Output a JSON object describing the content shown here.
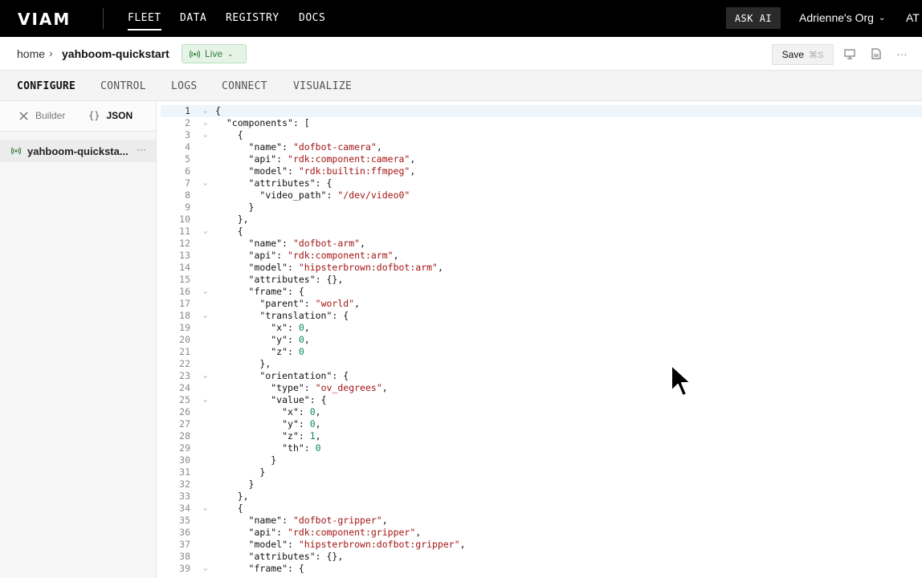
{
  "nav": {
    "logo": "VIAM",
    "links": [
      "FLEET",
      "DATA",
      "REGISTRY",
      "DOCS"
    ],
    "active_link": "FLEET",
    "ask_ai": "ASK AI",
    "org": "Adrienne's Org",
    "user_initials": "AT"
  },
  "breadcrumb": {
    "home": "home",
    "separator": "›",
    "machine": "yahboom-quickstart",
    "status": "Live"
  },
  "toolbar": {
    "save_label": "Save",
    "save_shortcut": "⌘S"
  },
  "tabs": [
    "CONFIGURE",
    "CONTROL",
    "LOGS",
    "CONNECT",
    "VISUALIZE"
  ],
  "active_tab": "CONFIGURE",
  "sidebar": {
    "mode_builder": "Builder",
    "mode_json_brace": "{}",
    "mode_json": "JSON",
    "machine_name": "yahboom-quicksta...",
    "more": "···"
  },
  "colors": {
    "accent_live": "#2e7d32",
    "string": "#a31515",
    "number": "#098658"
  },
  "editor": {
    "current_line": 1,
    "lines": [
      {
        "n": "1",
        "fold": true,
        "code": "{"
      },
      {
        "n": "2",
        "fold": true,
        "code": "  \"components\": ["
      },
      {
        "n": "3",
        "fold": true,
        "code": "    {"
      },
      {
        "n": "4",
        "fold": false,
        "code": "      \"name\": \"dofbot-camera\","
      },
      {
        "n": "5",
        "fold": false,
        "code": "      \"api\": \"rdk:component:camera\","
      },
      {
        "n": "6",
        "fold": false,
        "code": "      \"model\": \"rdk:builtin:ffmpeg\","
      },
      {
        "n": "7",
        "fold": true,
        "code": "      \"attributes\": {"
      },
      {
        "n": "8",
        "fold": false,
        "code": "        \"video_path\": \"/dev/video0\""
      },
      {
        "n": "9",
        "fold": false,
        "code": "      }"
      },
      {
        "n": "10",
        "fold": false,
        "code": "    },"
      },
      {
        "n": "11",
        "fold": true,
        "code": "    {"
      },
      {
        "n": "12",
        "fold": false,
        "code": "      \"name\": \"dofbot-arm\","
      },
      {
        "n": "13",
        "fold": false,
        "code": "      \"api\": \"rdk:component:arm\","
      },
      {
        "n": "14",
        "fold": false,
        "code": "      \"model\": \"hipsterbrown:dofbot:arm\","
      },
      {
        "n": "15",
        "fold": false,
        "code": "      \"attributes\": {},"
      },
      {
        "n": "16",
        "fold": true,
        "code": "      \"frame\": {"
      },
      {
        "n": "17",
        "fold": false,
        "code": "        \"parent\": \"world\","
      },
      {
        "n": "18",
        "fold": true,
        "code": "        \"translation\": {"
      },
      {
        "n": "19",
        "fold": false,
        "code": "          \"x\": 0,"
      },
      {
        "n": "20",
        "fold": false,
        "code": "          \"y\": 0,"
      },
      {
        "n": "21",
        "fold": false,
        "code": "          \"z\": 0"
      },
      {
        "n": "22",
        "fold": false,
        "code": "        },"
      },
      {
        "n": "23",
        "fold": true,
        "code": "        \"orientation\": {"
      },
      {
        "n": "24",
        "fold": false,
        "code": "          \"type\": \"ov_degrees\","
      },
      {
        "n": "25",
        "fold": true,
        "code": "          \"value\": {"
      },
      {
        "n": "26",
        "fold": false,
        "code": "            \"x\": 0,"
      },
      {
        "n": "27",
        "fold": false,
        "code": "            \"y\": 0,"
      },
      {
        "n": "28",
        "fold": false,
        "code": "            \"z\": 1,"
      },
      {
        "n": "29",
        "fold": false,
        "code": "            \"th\": 0"
      },
      {
        "n": "30",
        "fold": false,
        "code": "          }"
      },
      {
        "n": "31",
        "fold": false,
        "code": "        }"
      },
      {
        "n": "32",
        "fold": false,
        "code": "      }"
      },
      {
        "n": "33",
        "fold": false,
        "code": "    },"
      },
      {
        "n": "34",
        "fold": true,
        "code": "    {"
      },
      {
        "n": "35",
        "fold": false,
        "code": "      \"name\": \"dofbot-gripper\","
      },
      {
        "n": "36",
        "fold": false,
        "code": "      \"api\": \"rdk:component:gripper\","
      },
      {
        "n": "37",
        "fold": false,
        "code": "      \"model\": \"hipsterbrown:dofbot:gripper\","
      },
      {
        "n": "38",
        "fold": false,
        "code": "      \"attributes\": {},"
      },
      {
        "n": "39",
        "fold": true,
        "code": "      \"frame\": {"
      }
    ]
  }
}
